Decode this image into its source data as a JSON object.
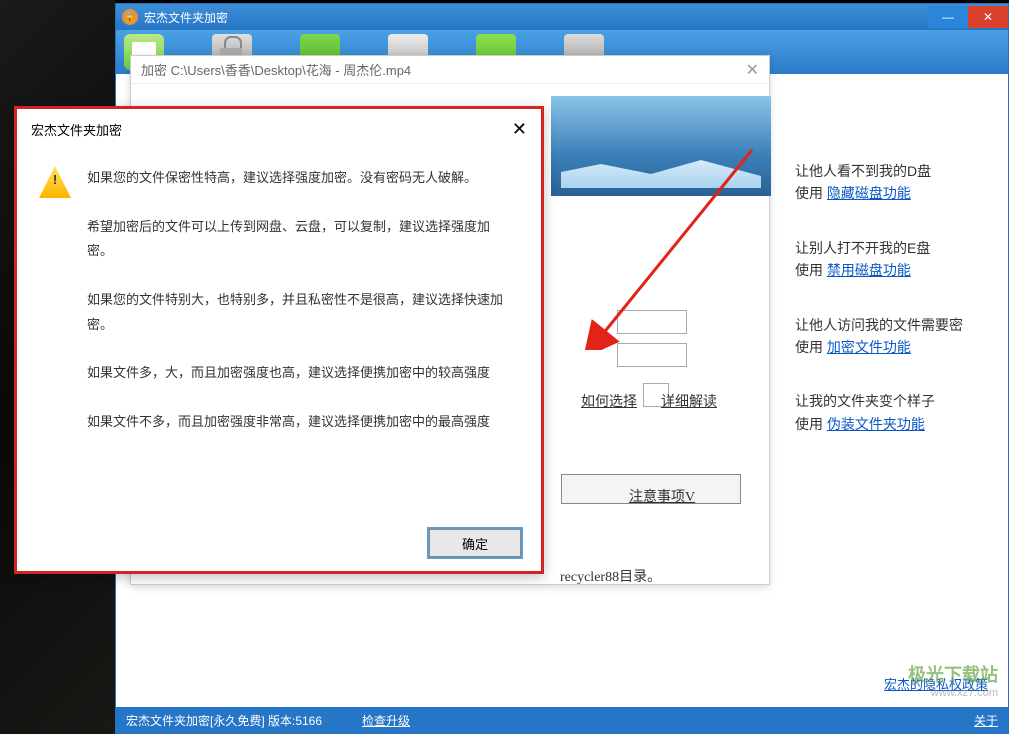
{
  "main_window": {
    "title": "宏杰文件夹加密",
    "toolbar_icons": [
      "home",
      "lock",
      "hdd",
      "disk",
      "folder",
      "print"
    ]
  },
  "encrypt_dialog": {
    "title": "加密 C:\\Users\\香香\\Desktop\\花海 - 周杰伦.mp4",
    "how_choose": "如何选择",
    "detail": "详细解读",
    "notice": "注意事项V",
    "recycler": "recycler88目录。"
  },
  "side_tips": [
    {
      "title": "让他人看不到我的D盘",
      "use": "使用 ",
      "link": "隐藏磁盘功能"
    },
    {
      "title": "让别人打不开我的E盘",
      "use": "使用 ",
      "link": "禁用磁盘功能"
    },
    {
      "title": "让他人访问我的文件需要密",
      "use": "使用 ",
      "link": "加密文件功能"
    },
    {
      "title": "让我的文件夹变个样子",
      "use": "使用 ",
      "link": "伪装文件夹功能"
    }
  ],
  "info_modal": {
    "title": "宏杰文件夹加密",
    "p1": "如果您的文件保密性特高，建议选择强度加密。没有密码无人破解。",
    "p2": "希望加密后的文件可以上传到网盘、云盘，可以复制，建议选择强度加密。",
    "p3": "如果您的文件特别大，也特别多，并且私密性不是很高，建议选择快速加密。",
    "p4": "如果文件多，大，而且加密强度也高，建议选择便携加密中的较高强度",
    "p5": "如果文件不多，而且加密强度非常高，建议选择便携加密中的最高强度",
    "ok": "确定"
  },
  "footer": {
    "status": "宏杰文件夹加密[永久免费]  版本:5166",
    "check_update": "检查升级",
    "about": "关于"
  },
  "privacy": "宏杰的隐私权政策",
  "watermark": {
    "text": "极光下载站",
    "url": "www.xz7.com"
  }
}
